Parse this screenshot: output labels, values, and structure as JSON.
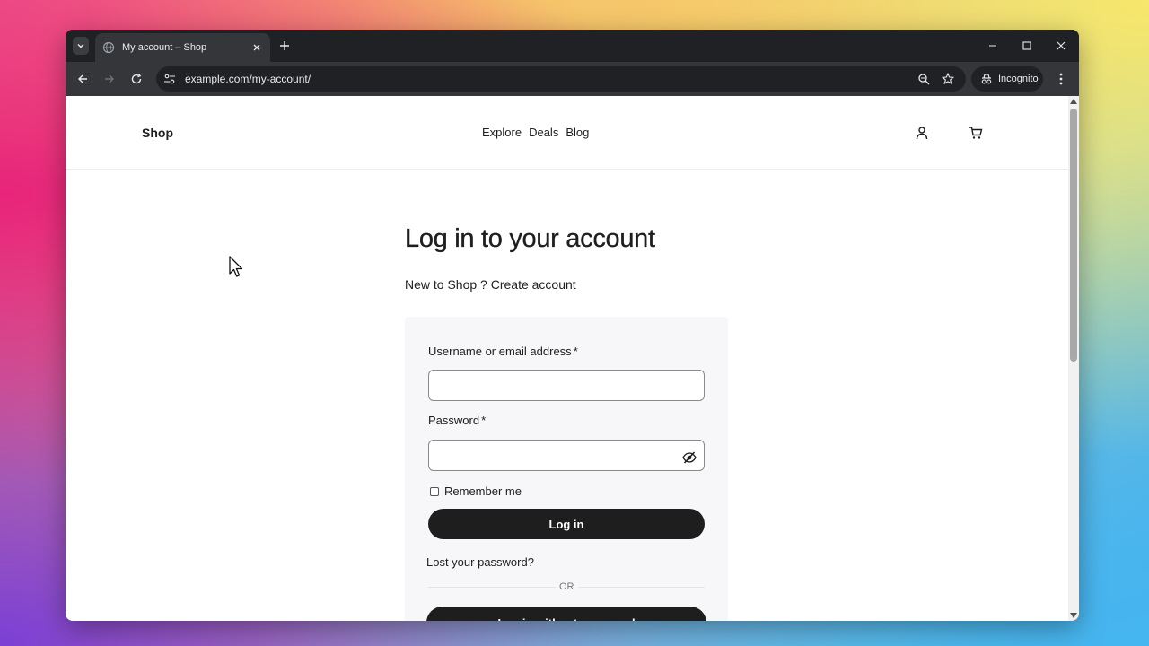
{
  "browser": {
    "tab_title": "My account – Shop",
    "url": "example.com/my-account/",
    "incognito_label": "Incognito"
  },
  "site": {
    "brand": "Shop",
    "nav": [
      "Explore",
      "Deals",
      "Blog"
    ]
  },
  "login": {
    "heading": "Log in to your account",
    "signup_prompt": "New to Shop ? Create account",
    "username_label": "Username or email address",
    "password_label": "Password",
    "required_mark": "*",
    "username_value": "",
    "password_value": "",
    "remember_label": "Remember me",
    "login_button": "Log in",
    "lost_password": "Lost your password?",
    "or_label": "OR",
    "passwordless_button": "Log in without password"
  },
  "colors": {
    "button_dark": "#1e1e1e",
    "card_bg": "#f7f7f9",
    "chrome_bg": "#202124"
  }
}
